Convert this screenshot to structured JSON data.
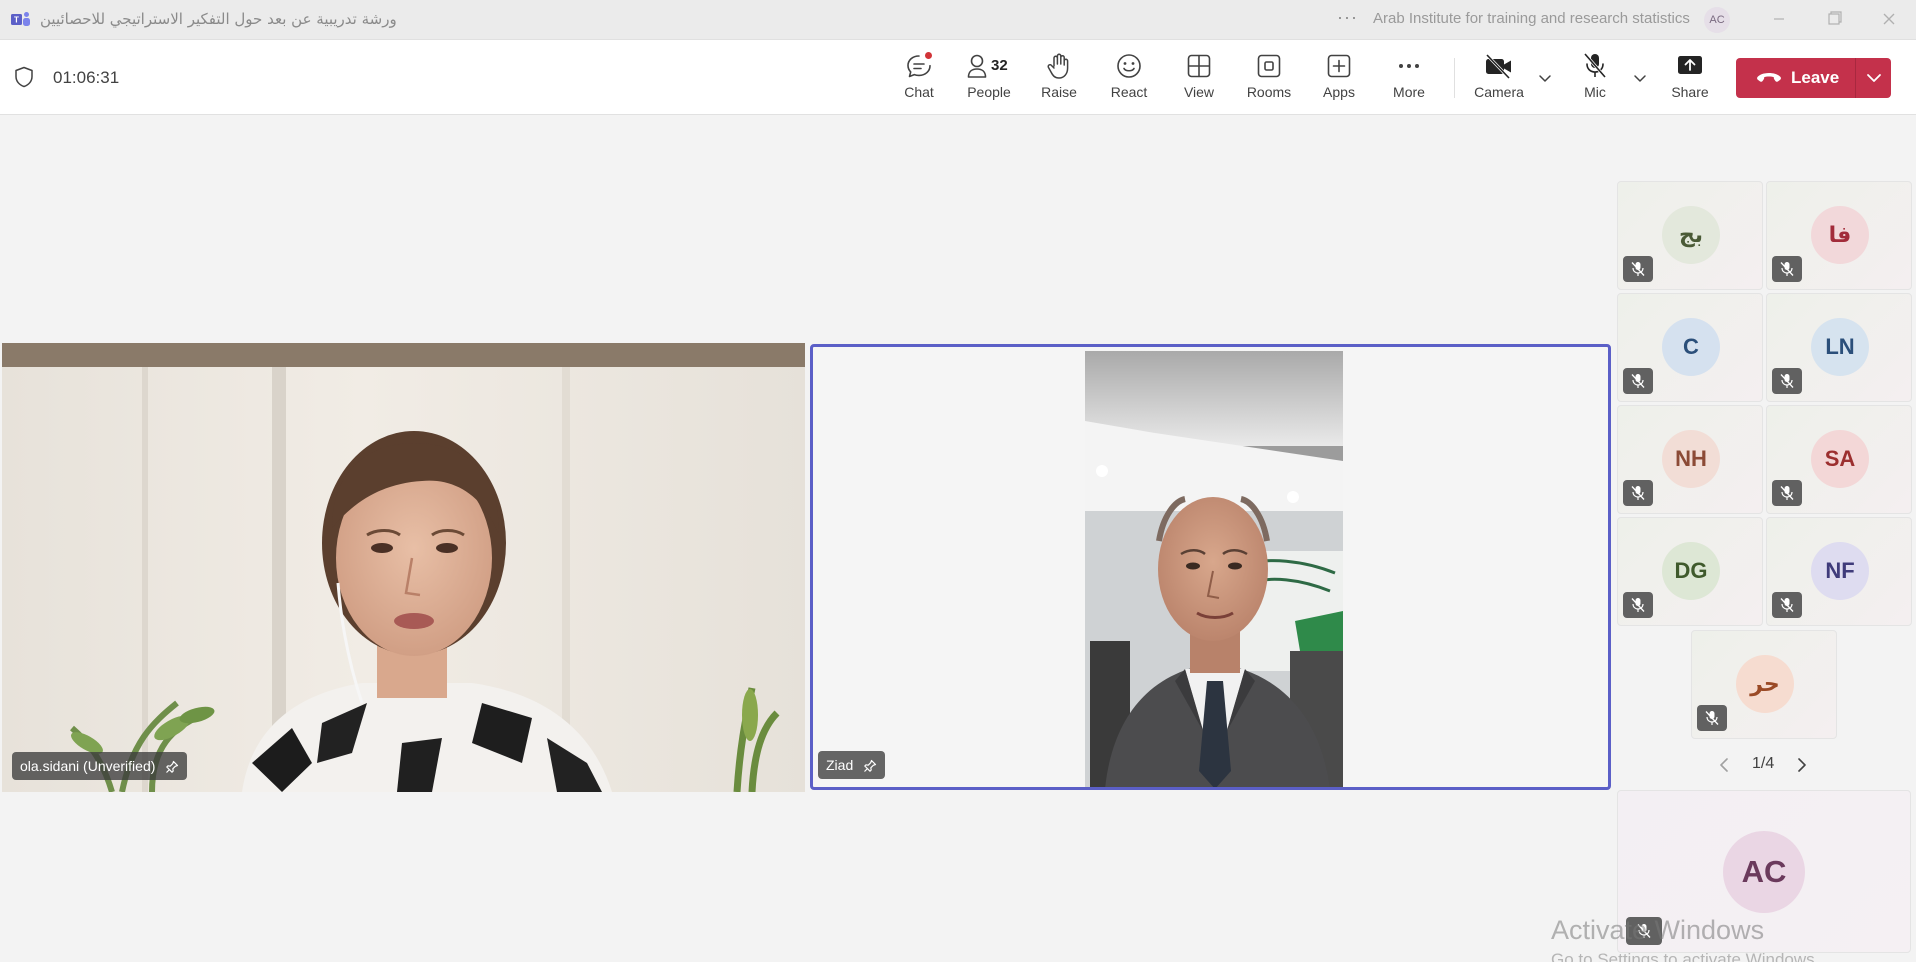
{
  "window": {
    "title": "ورشة تدريبية عن بعد حول التفكير الاستراتيجي للاحصائيين",
    "org": "Arab Institute for training and research statistics",
    "user_initials": "AC",
    "more_dots": "···"
  },
  "toolbar": {
    "timer": "01:06:31",
    "people_count": "32",
    "items": {
      "chat": "Chat",
      "people": "People",
      "raise": "Raise",
      "react": "React",
      "view": "View",
      "rooms": "Rooms",
      "apps": "Apps",
      "more": "More",
      "camera": "Camera",
      "mic": "Mic",
      "share": "Share"
    },
    "leave_label": "Leave",
    "leave_color": "#c4314b"
  },
  "stage": {
    "tiles": [
      {
        "name": "ola.sidani (Unverified)",
        "pinned": true
      },
      {
        "name": "Ziad",
        "pinned": true,
        "active_speaker_color": "#5b5fc7"
      }
    ]
  },
  "gallery": {
    "participants": [
      {
        "initials": "بج",
        "muted": true,
        "avatar_bg": "#e3e8dc",
        "avatar_fg": "#4a5a36"
      },
      {
        "initials": "فا",
        "muted": true,
        "avatar_bg": "#f2d8da",
        "avatar_fg": "#a22c3a"
      },
      {
        "initials": "C",
        "muted": true,
        "avatar_bg": "#d5e1ef",
        "avatar_fg": "#2b4f7a"
      },
      {
        "initials": "LN",
        "muted": true,
        "avatar_bg": "#d6e3ef",
        "avatar_fg": "#2b4f7a"
      },
      {
        "initials": "NH",
        "muted": true,
        "avatar_bg": "#f2ddd6",
        "avatar_fg": "#8c4a36"
      },
      {
        "initials": "SA",
        "muted": true,
        "avatar_bg": "#f3d7d7",
        "avatar_fg": "#9c2f2f"
      },
      {
        "initials": "DG",
        "muted": true,
        "avatar_bg": "#dde7d5",
        "avatar_fg": "#3f5a2c"
      },
      {
        "initials": "NF",
        "muted": true,
        "avatar_bg": "#dedcf0",
        "avatar_fg": "#3f3b7a"
      },
      {
        "initials": "حر",
        "muted": true,
        "avatar_bg": "#f6dcd0",
        "avatar_fg": "#9a4a26"
      }
    ],
    "pager_label": "1/4"
  },
  "self_view": {
    "initials": "AC",
    "muted": true
  },
  "os_watermark": {
    "line1": "Activate Windows",
    "line2": "Go to Settings to activate Windows."
  }
}
